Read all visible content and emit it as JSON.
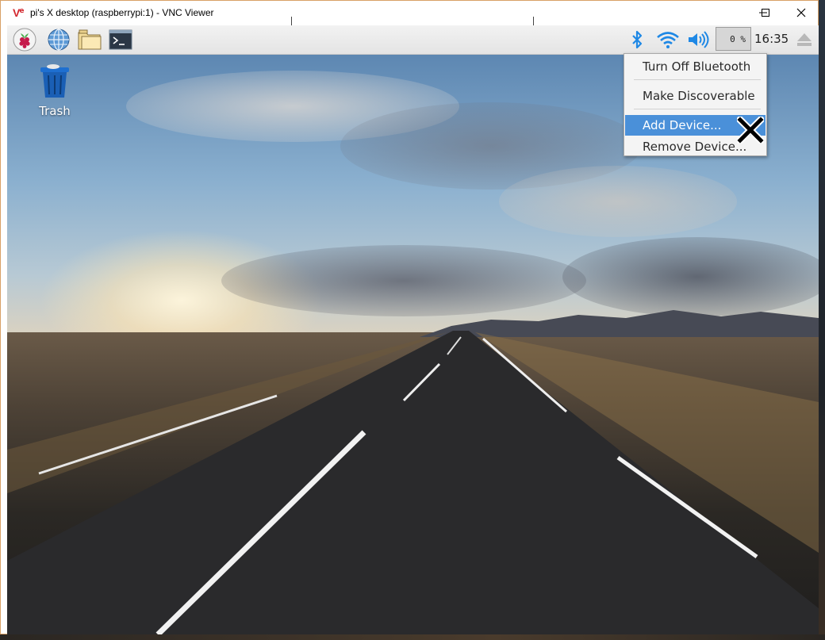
{
  "window": {
    "title": "pi's X desktop (raspberrypi:1) - VNC Viewer",
    "logo_v": "V",
    "logo_e": "e",
    "minimize_icon": "minimize-icon",
    "maximize_icon": "maximize-icon",
    "close_icon": "close-icon"
  },
  "panel": {
    "launchers": [
      "raspberry-menu-icon",
      "web-browser-icon",
      "file-manager-icon",
      "terminal-icon"
    ],
    "tray": {
      "bluetooth_icon": "bluetooth-icon",
      "wifi_icon": "wifi-icon",
      "volume_icon": "volume-icon",
      "cpu_usage": "0 %",
      "clock": "16:35",
      "eject_icon": "eject-icon"
    }
  },
  "desktop": {
    "icons": [
      {
        "label": "Trash",
        "icon": "trash-icon"
      }
    ]
  },
  "bluetooth_menu": {
    "items": [
      {
        "label": "Turn Off Bluetooth",
        "selected": false
      },
      {
        "label": "Make Discoverable",
        "selected": false
      },
      {
        "label": "Add Device...",
        "selected": true
      },
      {
        "label": "Remove Device...",
        "selected": false
      }
    ]
  },
  "colors": {
    "accent": "#4a90d9",
    "bluetooth": "#1e88e5",
    "brand_vnc": "#d3282f",
    "window_border": "#d9a066"
  }
}
